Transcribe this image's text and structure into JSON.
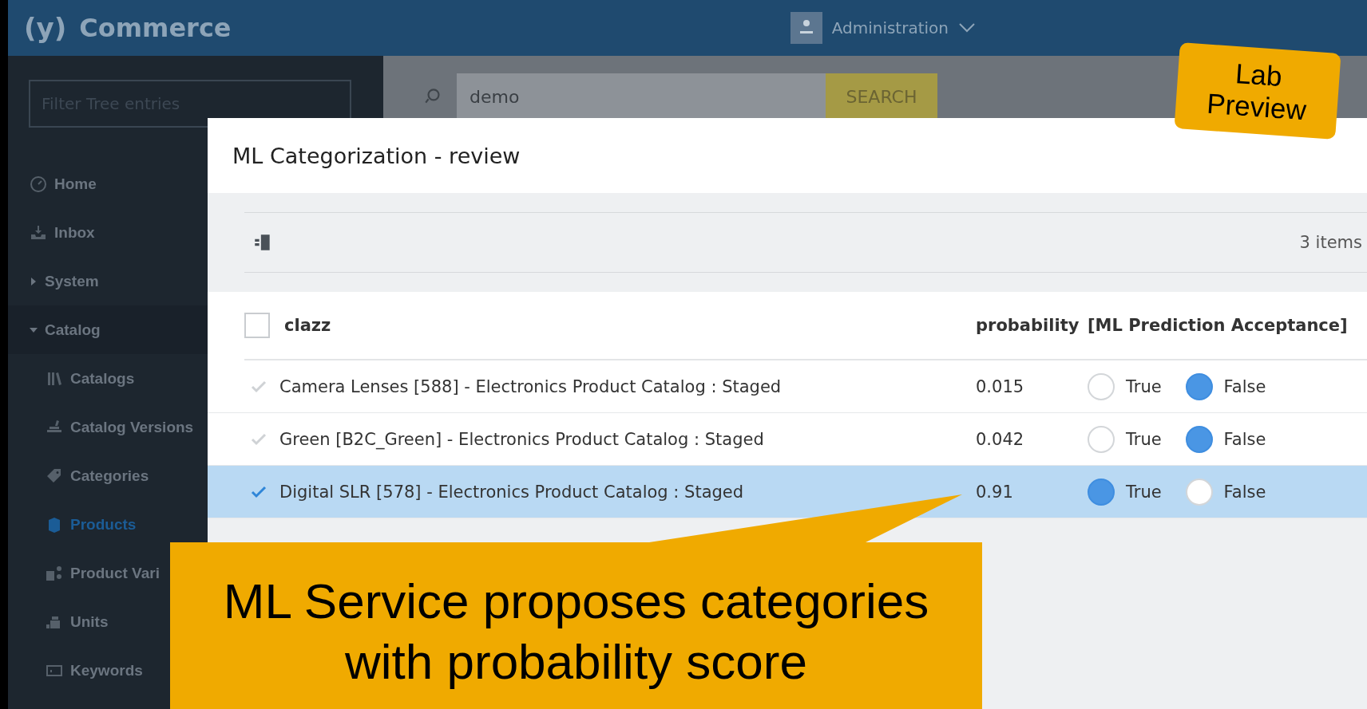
{
  "header": {
    "logo_mark": "(y)",
    "app_name": "Commerce",
    "user_menu": "Administration"
  },
  "sidebar": {
    "filter": {
      "placeholder": "Filter Tree entries"
    },
    "items": [
      {
        "label": "Home",
        "kind": "home",
        "selected": false
      },
      {
        "label": "Inbox",
        "kind": "inbox",
        "selected": false
      },
      {
        "label": "System",
        "kind": "folder",
        "selected": false,
        "expanded": false
      },
      {
        "label": "Catalog",
        "kind": "folder",
        "selected": false,
        "expanded": true,
        "children": [
          {
            "label": "Catalogs",
            "kind": "catalogs",
            "selected": false
          },
          {
            "label": "Catalog Versions",
            "kind": "versions",
            "selected": false
          },
          {
            "label": "Categories",
            "kind": "tag",
            "selected": false
          },
          {
            "label": "Products",
            "kind": "box",
            "selected": true
          },
          {
            "label": "Product Vari",
            "kind": "variants",
            "selected": false
          },
          {
            "label": "Units",
            "kind": "units",
            "selected": false
          },
          {
            "label": "Keywords",
            "kind": "keywords",
            "selected": false
          }
        ]
      }
    ]
  },
  "search": {
    "value": "demo",
    "button": "SEARCH"
  },
  "modal": {
    "title": "ML Categorization - review",
    "count": "3 items",
    "table": {
      "select_all": {
        "checked": false
      },
      "columns": [
        "clazz",
        "probability",
        "[ML Prediction Acceptance]"
      ],
      "rows": [
        {
          "clazz": "Camera Lenses [588] - Electronics Product Catalog : Staged",
          "probability": "0.015",
          "selected": false,
          "accepted": false,
          "true_label": "True",
          "false_label": "False"
        },
        {
          "clazz": "Green [B2C_Green] - Electronics Product Catalog : Staged",
          "probability": "0.042",
          "selected": false,
          "accepted": false,
          "true_label": "True",
          "false_label": "False"
        },
        {
          "clazz": "Digital SLR [578] - Electronics Product Catalog : Staged",
          "probability": "0.91",
          "selected": true,
          "accepted": true,
          "true_label": "True",
          "false_label": "False"
        }
      ]
    }
  },
  "callout": {
    "text": "ML Service proposes categories\nwith probability score"
  },
  "badge": {
    "text": "Lab\nPreview"
  }
}
